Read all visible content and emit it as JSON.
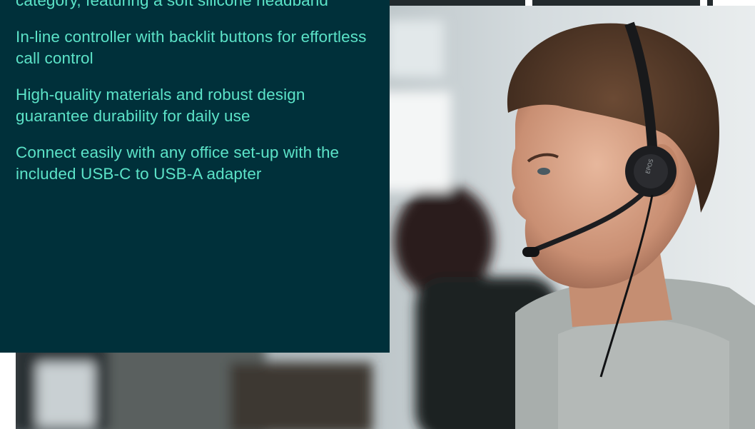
{
  "features": [
    "category, featuring a soft silicone headband",
    "In-line controller with backlit buttons for effortless call control",
    "High-quality materials and robust design guarantee durability for daily use",
    "Connect easily with any office set-up with the included USB-C to USB-A adapter"
  ],
  "photo": {
    "subject": "person-wearing-headset",
    "headset_brand_mark": "EPOS"
  },
  "colors": {
    "panel_background": "#00303a",
    "panel_text": "#5ce3c8",
    "page_background": "#ffffff"
  }
}
